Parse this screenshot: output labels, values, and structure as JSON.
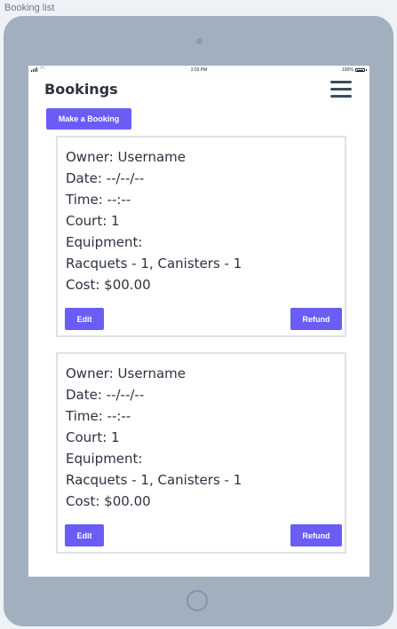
{
  "frame": {
    "title": "Booking list"
  },
  "status_bar": {
    "time": "3:03 PM",
    "battery": "100%"
  },
  "header": {
    "title": "Bookings",
    "menu_icon": "hamburger-menu-icon"
  },
  "actions": {
    "make_booking": "Make a Booking"
  },
  "bookings": [
    {
      "owner": "Owner: Username",
      "date": "Date: --/--/--",
      "time": "Time: --:--",
      "court": "Court: 1",
      "equipment_label": "Equipment:",
      "equipment": "Racquets - 1, Canisters - 1",
      "cost": "Cost: $00.00",
      "edit_label": "Edit",
      "refund_label": "Refund"
    },
    {
      "owner": "Owner: Username",
      "date": "Date: --/--/--",
      "time": "Time: --:--",
      "court": "Court: 1",
      "equipment_label": "Equipment:",
      "equipment": "Racquets - 1, Canisters - 1",
      "cost": "Cost: $00.00",
      "edit_label": "Edit",
      "refund_label": "Refund"
    }
  ],
  "colors": {
    "accent": "#6a5cf4",
    "text": "#2b3240",
    "device": "#a1afbf"
  }
}
